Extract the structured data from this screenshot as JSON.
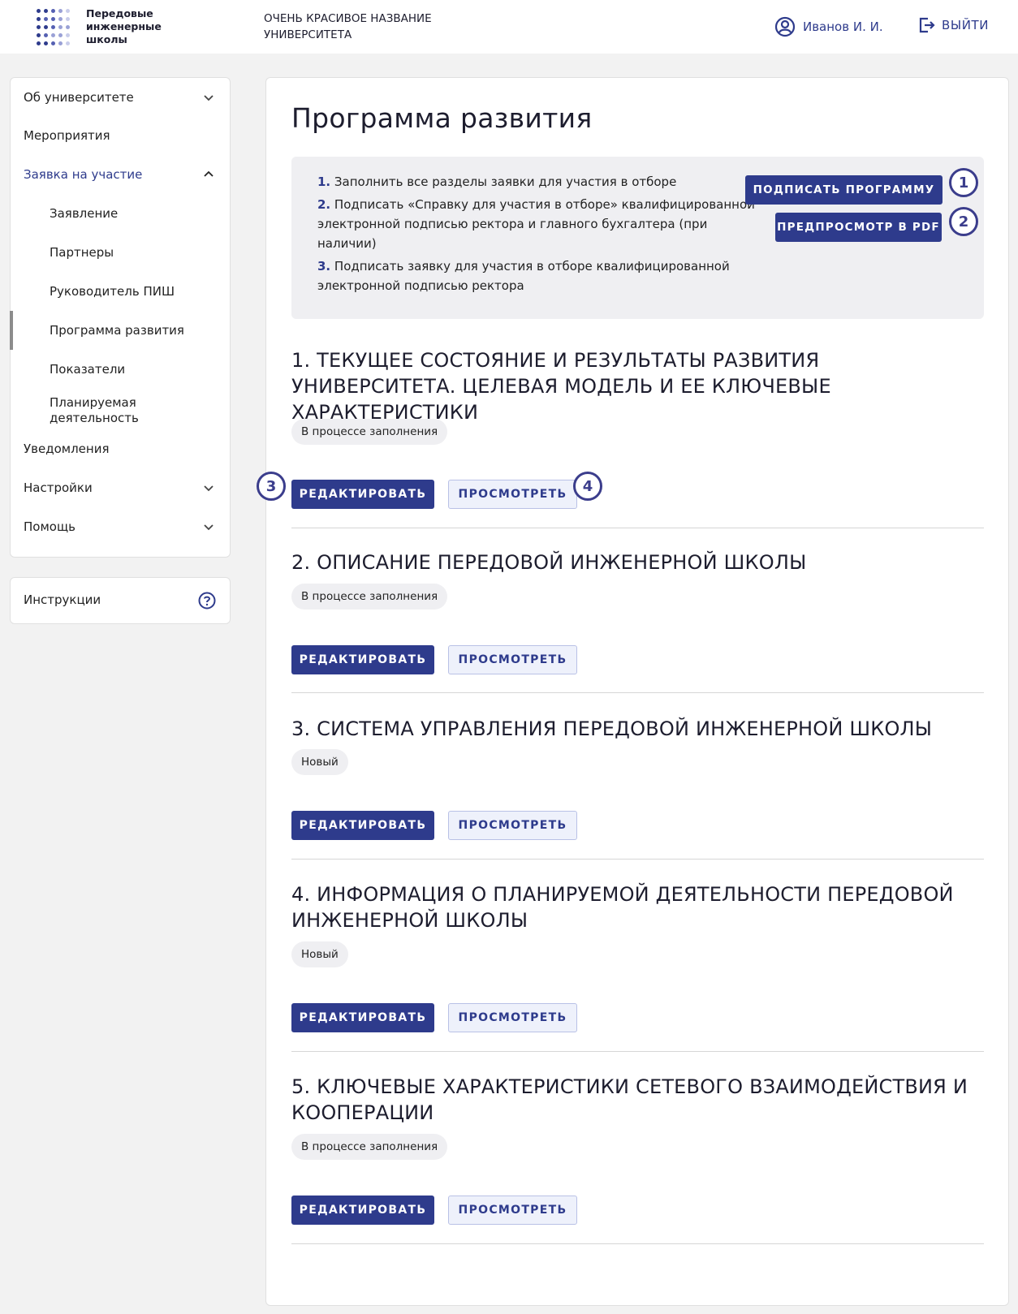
{
  "header": {
    "logo_text": "Передовые инженерные школы",
    "university_name": "ОЧЕНЬ КРАСИВОЕ НАЗВАНИЕ УНИВЕРСИТЕТА",
    "user_name": "Иванов И. И.",
    "logout_label": "ВЫЙТИ"
  },
  "sidebar": {
    "items": [
      {
        "label": "Об университете"
      },
      {
        "label": "Мероприятия"
      },
      {
        "label": "Заявка на участие"
      },
      {
        "label": "Заявление"
      },
      {
        "label": "Партнеры"
      },
      {
        "label": "Руководитель ПИШ"
      },
      {
        "label": "Программа развития"
      },
      {
        "label": "Показатели"
      },
      {
        "label": "Планируемая деятельность"
      },
      {
        "label": "Уведомления"
      },
      {
        "label": "Настройки"
      },
      {
        "label": "Помощь"
      }
    ],
    "instructions_label": "Инструкции"
  },
  "main": {
    "title": "Программа развития",
    "steps": [
      {
        "num": "1.",
        "text": "Заполнить все разделы заявки для участия в отборе"
      },
      {
        "num": "2.",
        "text": "Подписать «Справку для участия в отборе» квалифицированной электронной подписью ректора и главного бухгалтера (при наличии)"
      },
      {
        "num": "3.",
        "text": "Подписать заявку для участия в отборе квалифицированной электронной подписью ректора"
      }
    ],
    "sign_button": "ПОДПИСАТЬ ПРОГРАММУ",
    "pdf_button": "ПРЕДПРОСМОТР В PDF",
    "edit_label": "РЕДАКТИРОВАТЬ",
    "view_label": "ПРОСМОТРЕТЬ",
    "sections": [
      {
        "title": "1. ТЕКУЩЕЕ СОСТОЯНИЕ И РЕЗУЛЬТАТЫ РАЗВИТИЯ УНИВЕРСИТЕТА. ЦЕЛЕВАЯ МОДЕЛЬ И ЕЕ КЛЮЧЕВЫЕ ХАРАКТЕРИСТИКИ",
        "status": "В процессе заполнения"
      },
      {
        "title": "2. ОПИСАНИЕ ПЕРЕДОВОЙ ИНЖЕНЕРНОЙ ШКОЛЫ",
        "status": "В процессе заполнения"
      },
      {
        "title": "3. СИСТЕМА УПРАВЛЕНИЯ ПЕРЕДОВОЙ ИНЖЕНЕРНОЙ ШКОЛЫ",
        "status": "Новый"
      },
      {
        "title": "4. ИНФОРМАЦИЯ О ПЛАНИРУЕМОЙ ДЕЯТЕЛЬНОСТИ ПЕРЕДОВОЙ ИНЖЕНЕРНОЙ ШКОЛЫ",
        "status": "Новый"
      },
      {
        "title": "5. КЛЮЧЕВЫЕ ХАРАКТЕРИСТИКИ СЕТЕВОГО ВЗАИМОДЕЙСТВИЯ И КООПЕРАЦИИ",
        "status": "В процессе заполнения"
      }
    ]
  },
  "callouts": [
    "1",
    "2",
    "3",
    "4"
  ],
  "colors": {
    "accent": "#2e3b8c",
    "callout": "#3b3d8c",
    "page_bg": "#f2f2f2"
  },
  "icons": {
    "user": "user-circle-icon",
    "logout": "logout-icon",
    "chevron_down": "chevron-down-icon",
    "chevron_up": "chevron-up-icon",
    "help": "question-circle-icon"
  }
}
